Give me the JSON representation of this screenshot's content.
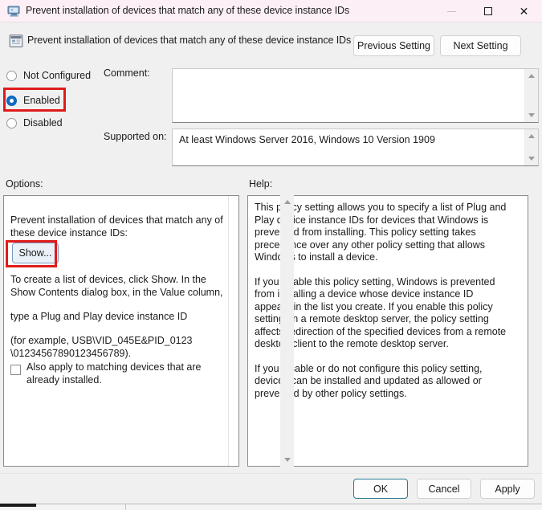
{
  "window": {
    "title": "Prevent installation of devices that match any of these device instance IDs",
    "title_icon": "monitor-icon",
    "controls": {
      "minimize": "minimize-icon",
      "maximize": "maximize-icon",
      "close": "close-icon"
    }
  },
  "header": {
    "icon": "policy-setting-icon",
    "title": "Prevent installation of devices that match any of these device instance IDs",
    "previous_label": "Previous Setting",
    "next_label": "Next Setting"
  },
  "state": {
    "options": [
      {
        "label": "Not Configured",
        "checked": false
      },
      {
        "label": "Enabled",
        "checked": true
      },
      {
        "label": "Disabled",
        "checked": false
      }
    ],
    "selected": "Enabled"
  },
  "comment": {
    "label": "Comment:",
    "value": "",
    "placeholder": ""
  },
  "supported": {
    "label": "Supported on:",
    "value": "At least Windows Server 2016, Windows 10 Version 1909"
  },
  "options_panel": {
    "label": "Options:",
    "heading": "Prevent installation of devices that match any of these device instance IDs:",
    "show_button": "Show...",
    "paragraphs": [
      "To create a list of devices, click Show. In the Show Contents dialog box, in the Value column,",
      "type a Plug and Play device instance ID",
      "(for example, USB\\VID_045E&PID_0123 \\01234567890123456789)."
    ],
    "checkbox": {
      "label": "Also apply to matching devices that are already installed.",
      "checked": false
    }
  },
  "help_panel": {
    "label": "Help:",
    "paragraphs": [
      "This policy setting allows you to specify a list of Plug and Play device instance IDs for devices that Windows is prevented from installing. This policy setting takes precedence over any other policy setting that allows Windows to install a device.",
      "If you enable this policy setting, Windows is prevented from installing a device whose device instance ID appears in the list you create. If you enable this policy setting on a remote desktop server, the policy setting affects redirection of the specified devices from a remote desktop client to the remote desktop server.",
      "If you disable or do not configure this policy setting, devices can be installed and updated as allowed or prevented by other policy settings."
    ]
  },
  "footer": {
    "ok_label": "OK",
    "cancel_label": "Cancel",
    "apply_label": "Apply"
  },
  "annotations": {
    "color": "#e01b1b",
    "highlighted": [
      "Enabled",
      "Show..."
    ]
  }
}
